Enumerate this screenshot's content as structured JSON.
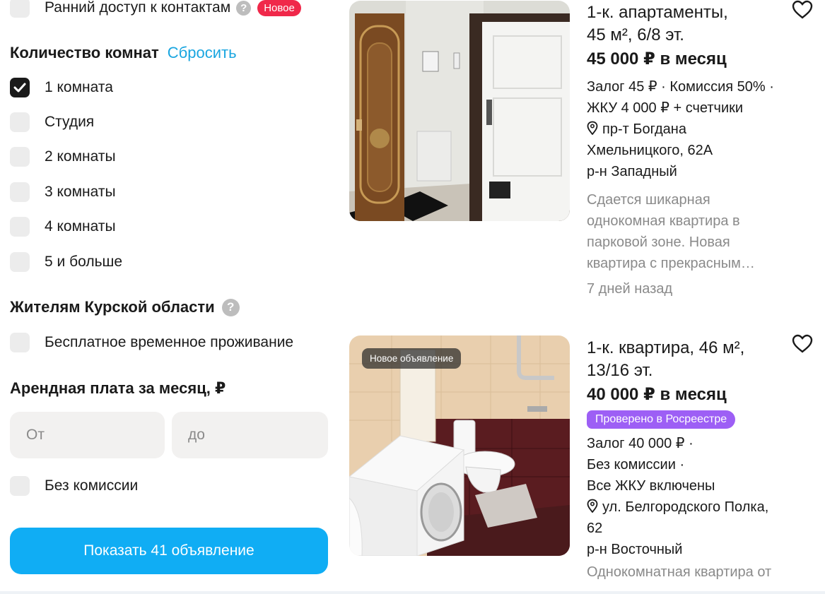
{
  "filters": {
    "early_access": {
      "label": "Ранний доступ к контактам",
      "help": "?",
      "badge": "Новое"
    },
    "rooms": {
      "title": "Количество комнат",
      "reset": "Сбросить",
      "options": [
        {
          "label": "1 комната",
          "checked": true
        },
        {
          "label": "Студия",
          "checked": false
        },
        {
          "label": "2 комнаты",
          "checked": false
        },
        {
          "label": "3 комнаты",
          "checked": false
        },
        {
          "label": "4 комнаты",
          "checked": false
        },
        {
          "label": "5 и больше",
          "checked": false
        }
      ]
    },
    "kursk": {
      "title": "Жителям Курской области",
      "help": "?",
      "option": "Бесплатное временное проживание"
    },
    "rent": {
      "title": "Арендная плата за месяц, ₽",
      "from_placeholder": "От",
      "to_placeholder": "до"
    },
    "no_commission": "Без комиссии",
    "show_button": "Показать 41 объявление"
  },
  "listings": [
    {
      "title_line1": "1-к. апартаменты,",
      "title_line2": "45 м², 6/8 эт.",
      "price": "45 000 ₽ в месяц",
      "terms_line1": "Залог 45 ₽ · Комиссия 50% ·",
      "terms_line2": "ЖКУ 4 000 ₽ + счетчики",
      "address_line1": "пр-т Богдана",
      "address_line2": "Хмельницкого, 62А",
      "district": "р-н Западный",
      "desc_line1": "Сдается шикарная",
      "desc_line2": "однокомная квартира в",
      "desc_line3": "парковой зоне. Новая",
      "desc_line4": "квартира с прекрасным…",
      "posted": "7 дней назад"
    },
    {
      "photo_badge": "Новое объявление",
      "title_line1": "1-к. квартира, 46 м²,",
      "title_line2": "13/16 эт.",
      "price": "40 000 ₽ в месяц",
      "verified": "Проверено в Росреестре",
      "terms_line1": "Залог 40 000 ₽ ·",
      "terms_line2": "Без комиссии ·",
      "terms_line3": "Все ЖКУ включены",
      "address_line1": "ул. Белгородского Полка,",
      "address_line2": "62",
      "district": "р-н Восточный",
      "desc_line1": "Однокомнатная квартира от"
    }
  ],
  "colors": {
    "accent": "#10adf4",
    "link": "#1aa6e0",
    "badge_new": "#f0284a",
    "verified": "#9d5ff5"
  }
}
